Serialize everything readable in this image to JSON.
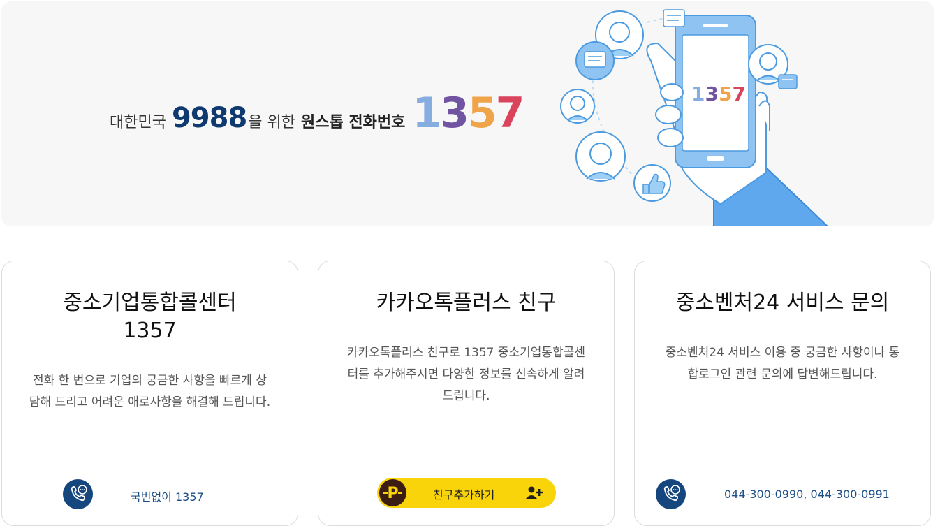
{
  "banner": {
    "prefix": "대한민국",
    "number": "9988",
    "middle": "을 위한",
    "bold": "원스톱 전화번호",
    "big_digits": [
      "1",
      "3",
      "5",
      "7"
    ],
    "big_colors": [
      "#86ade0",
      "#7054a2",
      "#f0a44a",
      "#d9445c"
    ],
    "phone_screen_text": "1357"
  },
  "cards": [
    {
      "title_line1": "중소기업통합콜센터",
      "title_line2": "1357",
      "desc": "전화 한 번으로 기업의 궁금한 사항을 빠르게 상담해 드리고 어려운 애로사항을 해결해 드립니다.",
      "contact": "국번없이 1357"
    },
    {
      "title_line1": "카카오톡플러스 친구",
      "desc": "카카오톡플러스 친구로 1357 중소기업통합콜센터를 추가해주시면 다양한 정보를 신속하게 알려드립니다.",
      "button_label": "친구추가하기"
    },
    {
      "title_line1": "중소벤처24 서비스 문의",
      "desc": "중소벤처24 서비스 이용 중 궁금한 사항이나 통합로그인 관련 문의에 답변해드립니다.",
      "contact": "044-300-0990, 044-300-0991"
    }
  ],
  "colors": {
    "accent_navy": "#15467e",
    "kakao_yellow": "#f9d40a"
  },
  "icons": [
    "phone-chat-icon",
    "kakao-plus-icon",
    "add-friend-icon",
    "avatar-icon",
    "speech-bubble-icon",
    "thumbs-up-icon"
  ]
}
